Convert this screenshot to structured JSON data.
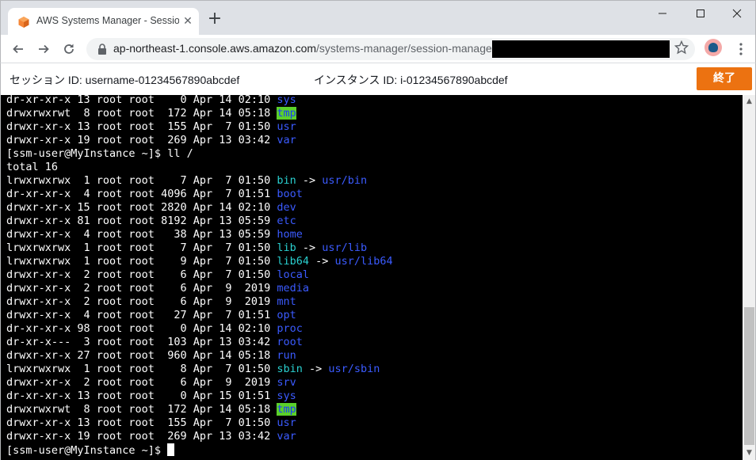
{
  "browser": {
    "tab_title": "AWS Systems Manager - Session Manager",
    "tab_close": "✕",
    "new_tab": "+",
    "url_host": "ap-northeast-1.console.aws.amazon.com",
    "url_path": "/systems-manager/session-manager/",
    "favicon_color": "#f58536"
  },
  "session": {
    "session_id": "セッション ID: username-01234567890abcdef",
    "instance_id": "インスタンス ID: i-01234567890abcdef",
    "end_button": "終了",
    "end_button_color": "#ec7211"
  },
  "terminal": {
    "lines": [
      {
        "pre": "dr-xr-xr-x 13 root root    0 Apr 14 02:10 ",
        "name": "sys",
        "kind": "dir"
      },
      {
        "pre": "drwxrwxrwt  8 root root  172 Apr 14 05:18 ",
        "name": "tmp",
        "kind": "sticky"
      },
      {
        "pre": "drwxr-xr-x 13 root root  155 Apr  7 01:50 ",
        "name": "usr",
        "kind": "dir"
      },
      {
        "pre": "drwxr-xr-x 19 root root  269 Apr 13 03:42 ",
        "name": "var",
        "kind": "dir"
      },
      {
        "pre": "[ssm-user@MyInstance ~]$ ll /",
        "kind": "plain"
      },
      {
        "pre": "total 16",
        "kind": "plain"
      },
      {
        "pre": "lrwxrwxrwx  1 root root    7 Apr  7 01:50 ",
        "name": "bin",
        "kind": "link",
        "arrow": " -> ",
        "target": "usr/bin"
      },
      {
        "pre": "dr-xr-xr-x  4 root root 4096 Apr  7 01:51 ",
        "name": "boot",
        "kind": "dir"
      },
      {
        "pre": "drwxr-xr-x 15 root root 2820 Apr 14 02:10 ",
        "name": "dev",
        "kind": "dir"
      },
      {
        "pre": "drwxr-xr-x 81 root root 8192 Apr 13 05:59 ",
        "name": "etc",
        "kind": "dir"
      },
      {
        "pre": "drwxr-xr-x  4 root root   38 Apr 13 05:59 ",
        "name": "home",
        "kind": "dir"
      },
      {
        "pre": "lrwxrwxrwx  1 root root    7 Apr  7 01:50 ",
        "name": "lib",
        "kind": "link",
        "arrow": " -> ",
        "target": "usr/lib"
      },
      {
        "pre": "lrwxrwxrwx  1 root root    9 Apr  7 01:50 ",
        "name": "lib64",
        "kind": "link",
        "arrow": " -> ",
        "target": "usr/lib64"
      },
      {
        "pre": "drwxr-xr-x  2 root root    6 Apr  7 01:50 ",
        "name": "local",
        "kind": "dir"
      },
      {
        "pre": "drwxr-xr-x  2 root root    6 Apr  9  2019 ",
        "name": "media",
        "kind": "dir"
      },
      {
        "pre": "drwxr-xr-x  2 root root    6 Apr  9  2019 ",
        "name": "mnt",
        "kind": "dir"
      },
      {
        "pre": "drwxr-xr-x  4 root root   27 Apr  7 01:51 ",
        "name": "opt",
        "kind": "dir"
      },
      {
        "pre": "dr-xr-xr-x 98 root root    0 Apr 14 02:10 ",
        "name": "proc",
        "kind": "dir"
      },
      {
        "pre": "dr-xr-x---  3 root root  103 Apr 13 03:42 ",
        "name": "root",
        "kind": "dir"
      },
      {
        "pre": "drwxr-xr-x 27 root root  960 Apr 14 05:18 ",
        "name": "run",
        "kind": "dir"
      },
      {
        "pre": "lrwxrwxrwx  1 root root    8 Apr  7 01:50 ",
        "name": "sbin",
        "kind": "link",
        "arrow": " -> ",
        "target": "usr/sbin"
      },
      {
        "pre": "drwxr-xr-x  2 root root    6 Apr  9  2019 ",
        "name": "srv",
        "kind": "dir"
      },
      {
        "pre": "dr-xr-xr-x 13 root root    0 Apr 15 01:51 ",
        "name": "sys",
        "kind": "dir"
      },
      {
        "pre": "drwxrwxrwt  8 root root  172 Apr 14 05:18 ",
        "name": "tmp",
        "kind": "sticky"
      },
      {
        "pre": "drwxr-xr-x 13 root root  155 Apr  7 01:50 ",
        "name": "usr",
        "kind": "dir"
      },
      {
        "pre": "drwxr-xr-x 19 root root  269 Apr 13 03:42 ",
        "name": "var",
        "kind": "dir"
      },
      {
        "pre": "[ssm-user@MyInstance ~]$ ",
        "kind": "prompt"
      }
    ]
  }
}
